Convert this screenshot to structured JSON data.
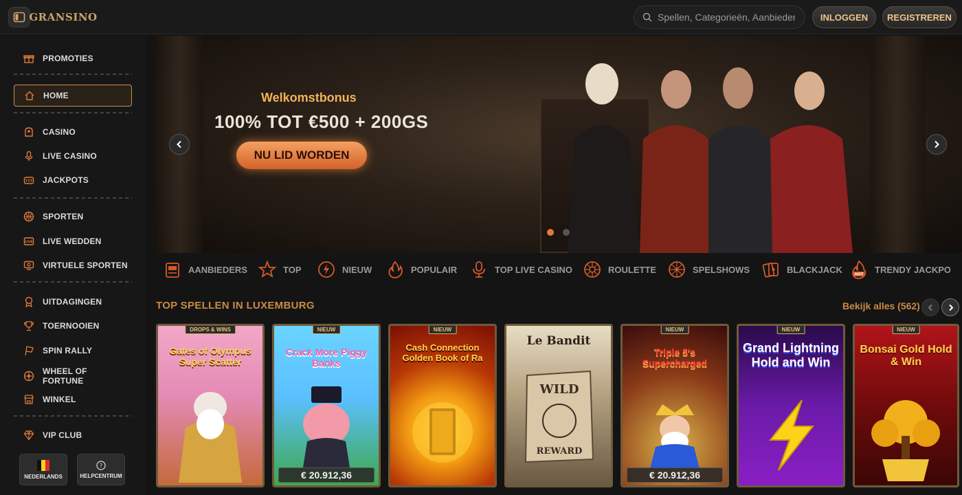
{
  "header": {
    "logo_text": "GRANSINO",
    "search_placeholder": "Spellen, Categorieën, Aanbieders",
    "login_label": "INLOGGEN",
    "register_label": "REGISTREREN"
  },
  "sidebar": {
    "items": [
      {
        "label": "PROMOTIES",
        "icon": "gift-icon"
      },
      {
        "label": "HOME",
        "icon": "home-icon",
        "active": true
      },
      {
        "label": "CASINO",
        "icon": "casino-icon"
      },
      {
        "label": "LIVE CASINO",
        "icon": "microphone-icon"
      },
      {
        "label": "JACKPOTS",
        "icon": "jackpot-icon"
      },
      {
        "label": "SPORTEN",
        "icon": "basketball-icon"
      },
      {
        "label": "LIVE WEDDEN",
        "icon": "live-icon"
      },
      {
        "label": "VIRTUELE SPORTEN",
        "icon": "virtual-icon"
      },
      {
        "label": "UITDAGINGEN",
        "icon": "medal-icon"
      },
      {
        "label": "TOERNOOIEN",
        "icon": "trophy-icon"
      },
      {
        "label": "SPIN RALLY",
        "icon": "flag-icon"
      },
      {
        "label": "WHEEL OF FORTUNE",
        "icon": "wheel-icon"
      },
      {
        "label": "WINKEL",
        "icon": "shop-icon"
      },
      {
        "label": "VIP CLUB",
        "icon": "diamond-icon"
      }
    ],
    "language_label": "NEDERLANDS",
    "help_label": "HELPCENTRUM"
  },
  "hero": {
    "subtitle": "Welkomstbonus",
    "title": "100% TOT €500 + 200GS",
    "cta_label": "NU LID WORDEN",
    "slide_count": 2,
    "active_slide": 1
  },
  "categories": [
    {
      "label": "AANBIEDERS",
      "icon": "slot-machine-icon"
    },
    {
      "label": "TOP",
      "icon": "star-icon"
    },
    {
      "label": "NIEUW",
      "icon": "lightning-icon"
    },
    {
      "label": "POPULAIR",
      "icon": "fire-icon"
    },
    {
      "label": "TOP LIVE CASINO",
      "icon": "microphone-icon"
    },
    {
      "label": "ROULETTE",
      "icon": "roulette-icon"
    },
    {
      "label": "SPELSHOWS",
      "icon": "wheel-icon"
    },
    {
      "label": "BLACKJACK",
      "icon": "cards-icon"
    },
    {
      "label": "TRENDY JACKPOT",
      "icon": "hot-icon"
    }
  ],
  "section": {
    "title": "TOP SPELLEN IN LUXEMBURG",
    "see_all": "Bekijk alles (562)"
  },
  "games": [
    {
      "name": "Gates of Olympus Super Scatter",
      "badge": "DROPS & WINS",
      "jackpot": "",
      "bg1": "#f3a7c7",
      "bg2": "#c56a3b"
    },
    {
      "name": "Crack More Piggy Banks",
      "badge": "NIEUW",
      "jackpot": "€ 20.912,36",
      "bg1": "#6ad4ff",
      "bg2": "#3fa84a"
    },
    {
      "name": "Cash Connection Golden Book of Ra",
      "badge": "NIEUW",
      "jackpot": "",
      "bg1": "#7a0f05",
      "bg2": "#f29a12"
    },
    {
      "name": "Le Bandit",
      "badge": "",
      "jackpot": "",
      "bg1": "#d9c7a8",
      "bg2": "#6b5a44"
    },
    {
      "name": "Triple 5's Supercharged",
      "badge": "NIEUW",
      "jackpot": "€ 20.912,36",
      "bg1": "#4a1212",
      "bg2": "#c4a24a"
    },
    {
      "name": "Grand Lightning Hold and Win",
      "badge": "NIEUW",
      "jackpot": "",
      "bg1": "#2a0a4a",
      "bg2": "#8a1fc4"
    },
    {
      "name": "Bonsai Gold Hold & Win",
      "badge": "NIEUW",
      "jackpot": "",
      "bg1": "#b0141a",
      "bg2": "#3b0606"
    }
  ],
  "colors": {
    "accent": "#c98a46",
    "cta": "#e07b3a"
  }
}
